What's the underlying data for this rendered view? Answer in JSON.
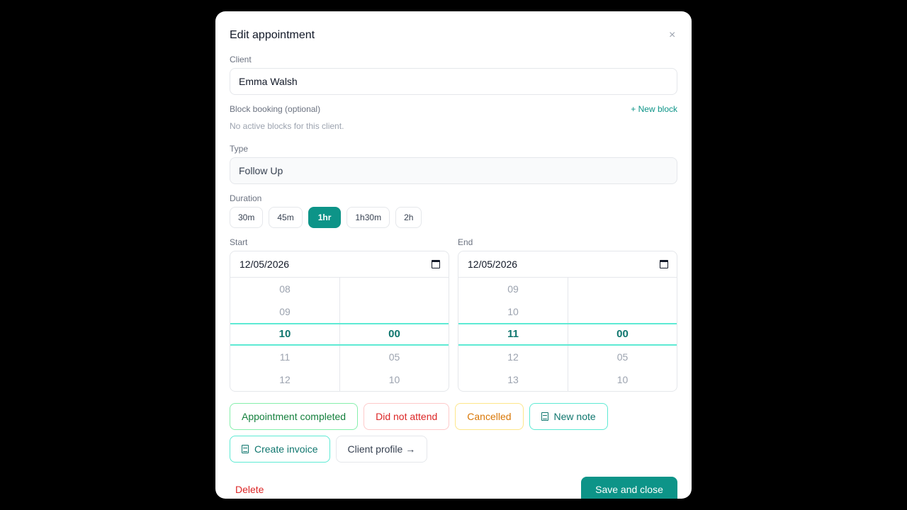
{
  "modal": {
    "title": "Edit appointment",
    "close_symbol": "×"
  },
  "client": {
    "label": "Client",
    "value": "Emma Walsh"
  },
  "block_booking": {
    "label": "Block booking (optional)",
    "new_block_label": "+ New block",
    "hint": "No active blocks for this client."
  },
  "type": {
    "label": "Type",
    "value": "Follow Up"
  },
  "duration": {
    "label": "Duration",
    "options": [
      "30m",
      "45m",
      "1hr",
      "1h30m",
      "2h"
    ],
    "selected": "1hr"
  },
  "start": {
    "label": "Start",
    "date": "12/05/2026",
    "hours": [
      "08",
      "09",
      "10",
      "11",
      "12"
    ],
    "minutes": [
      "",
      "",
      "00",
      "05",
      "10"
    ],
    "selected_hour": "10",
    "selected_minute": "00"
  },
  "end": {
    "label": "End",
    "date": "12/05/2026",
    "hours": [
      "09",
      "10",
      "11",
      "12",
      "13"
    ],
    "minutes": [
      "",
      "",
      "00",
      "05",
      "10"
    ],
    "selected_hour": "11",
    "selected_minute": "00"
  },
  "actions": {
    "completed": "Appointment completed",
    "dna": "Did not attend",
    "cancelled": "Cancelled",
    "new_note": "New note",
    "create_invoice": "Create invoice",
    "client_profile": "Client profile →"
  },
  "footer": {
    "delete_label": "Delete",
    "save_label": "Save and close"
  },
  "colors": {
    "accent": "#0d9488",
    "danger": "#dc2626",
    "warning": "#d97706",
    "success": "#15803d"
  }
}
